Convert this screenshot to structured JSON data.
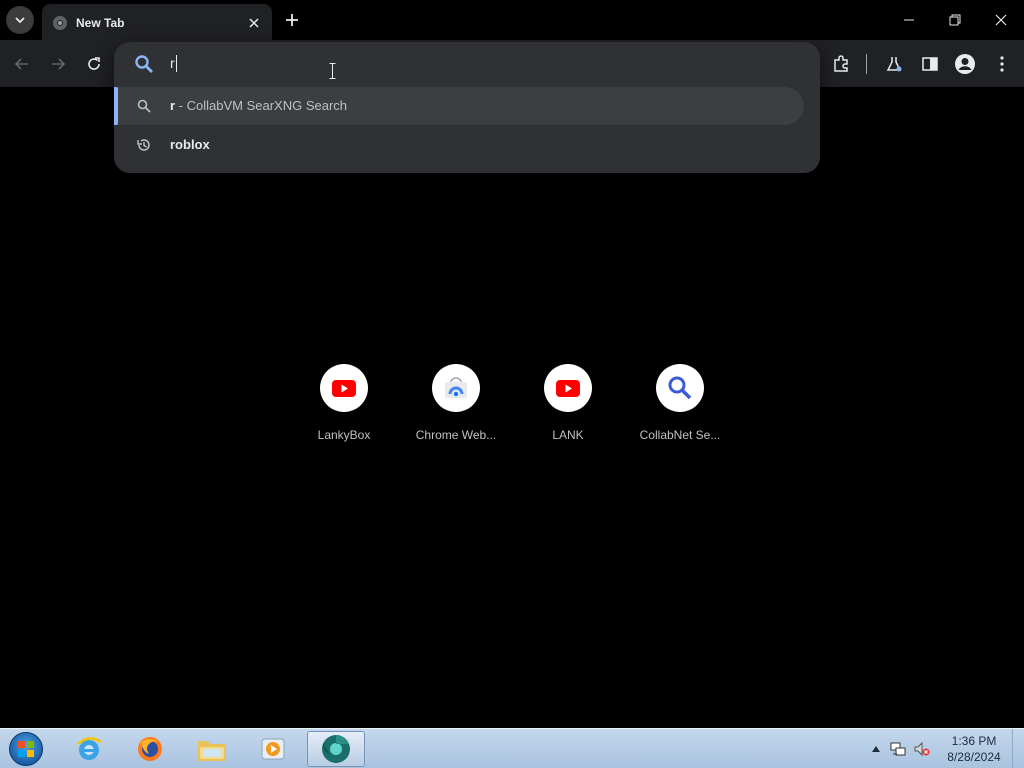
{
  "tab": {
    "title": "New Tab"
  },
  "omnibox": {
    "input_value": "r",
    "suggestions": [
      {
        "query": "r",
        "suffix": " - CollabVM SearXNG Search",
        "icon": "search-icon"
      },
      {
        "text": "roblox",
        "icon": "history-icon"
      }
    ]
  },
  "shortcuts": [
    {
      "label": "LankyBox",
      "icon": "youtube-icon"
    },
    {
      "label": "Chrome Web...",
      "icon": "chrome-web-store-icon"
    },
    {
      "label": "LANK",
      "icon": "youtube-icon"
    },
    {
      "label": "CollabNet Se...",
      "icon": "search-icon"
    }
  ],
  "taskbar": {
    "apps": [
      "internet-explorer",
      "firefox",
      "windows-explorer",
      "media-player",
      "chrome"
    ],
    "clock": {
      "time": "1:36 PM",
      "date": "8/28/2024"
    }
  },
  "colors": {
    "accent": "#8ab4f8",
    "youtube_red": "#ff0000",
    "omnibox_bg": "#303134"
  }
}
